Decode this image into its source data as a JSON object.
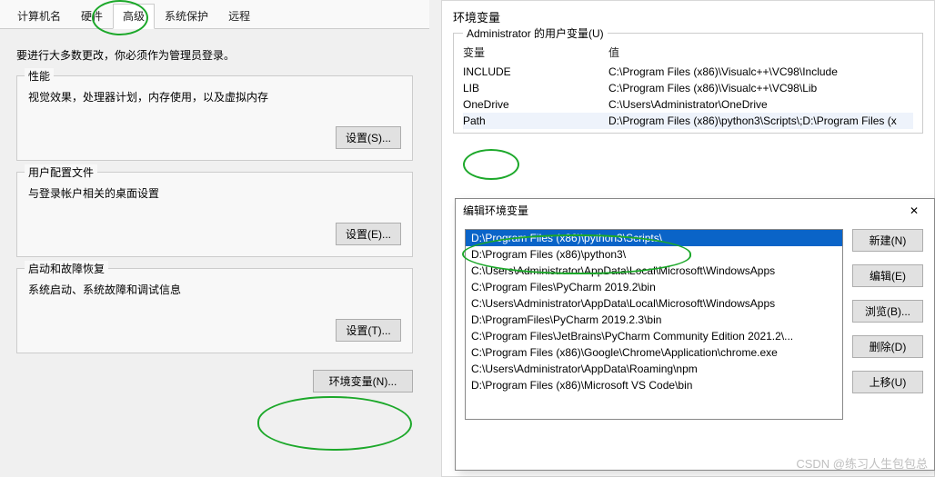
{
  "left": {
    "tabs": [
      "计算机名",
      "硬件",
      "高级",
      "系统保护",
      "远程"
    ],
    "active_tab_index": 2,
    "admin_msg": "要进行大多数更改，你必须作为管理员登录。",
    "groups": {
      "perf": {
        "title": "性能",
        "desc": "视觉效果，处理器计划，内存使用，以及虚拟内存",
        "btn": "设置(S)..."
      },
      "profile": {
        "title": "用户配置文件",
        "desc": "与登录帐户相关的桌面设置",
        "btn": "设置(E)..."
      },
      "recovery": {
        "title": "启动和故障恢复",
        "desc": "系统启动、系统故障和调试信息",
        "btn": "设置(T)..."
      }
    },
    "env_btn": "环境变量(N)..."
  },
  "env": {
    "window_title": "环境变量",
    "user_vars_title": "Administrator 的用户变量(U)",
    "columns": {
      "name": "变量",
      "value": "值"
    },
    "rows": [
      {
        "name": "INCLUDE",
        "value": "C:\\Program Files (x86)\\Visualc++\\VC98\\Include"
      },
      {
        "name": "LIB",
        "value": "C:\\Program Files (x86)\\Visualc++\\VC98\\Lib"
      },
      {
        "name": "OneDrive",
        "value": "C:\\Users\\Administrator\\OneDrive"
      },
      {
        "name": "Path",
        "value": "D:\\Program Files (x86)\\python3\\Scripts\\;D:\\Program Files (x"
      }
    ]
  },
  "edit": {
    "title": "编辑环境变量",
    "close": "✕",
    "paths": [
      "D:\\Program Files (x86)\\python3\\Scripts\\",
      "D:\\Program Files (x86)\\python3\\",
      "C:\\Users\\Administrator\\AppData\\Local\\Microsoft\\WindowsApps",
      "C:\\Program Files\\PyCharm 2019.2\\bin",
      "C:\\Users\\Administrator\\AppData\\Local\\Microsoft\\WindowsApps",
      "D:\\ProgramFiles\\PyCharm 2019.2.3\\bin",
      "C:\\Program Files\\JetBrains\\PyCharm Community Edition 2021.2\\...",
      "C:\\Program Files (x86)\\Google\\Chrome\\Application\\chrome.exe",
      "C:\\Users\\Administrator\\AppData\\Roaming\\npm",
      "D:\\Program Files (x86)\\Microsoft VS Code\\bin"
    ],
    "selected_index": 0,
    "buttons": {
      "new": "新建(N)",
      "edit": "编辑(E)",
      "browse": "浏览(B)...",
      "delete": "删除(D)",
      "up": "上移(U)"
    }
  },
  "watermark": "CSDN @练习人生包包总"
}
